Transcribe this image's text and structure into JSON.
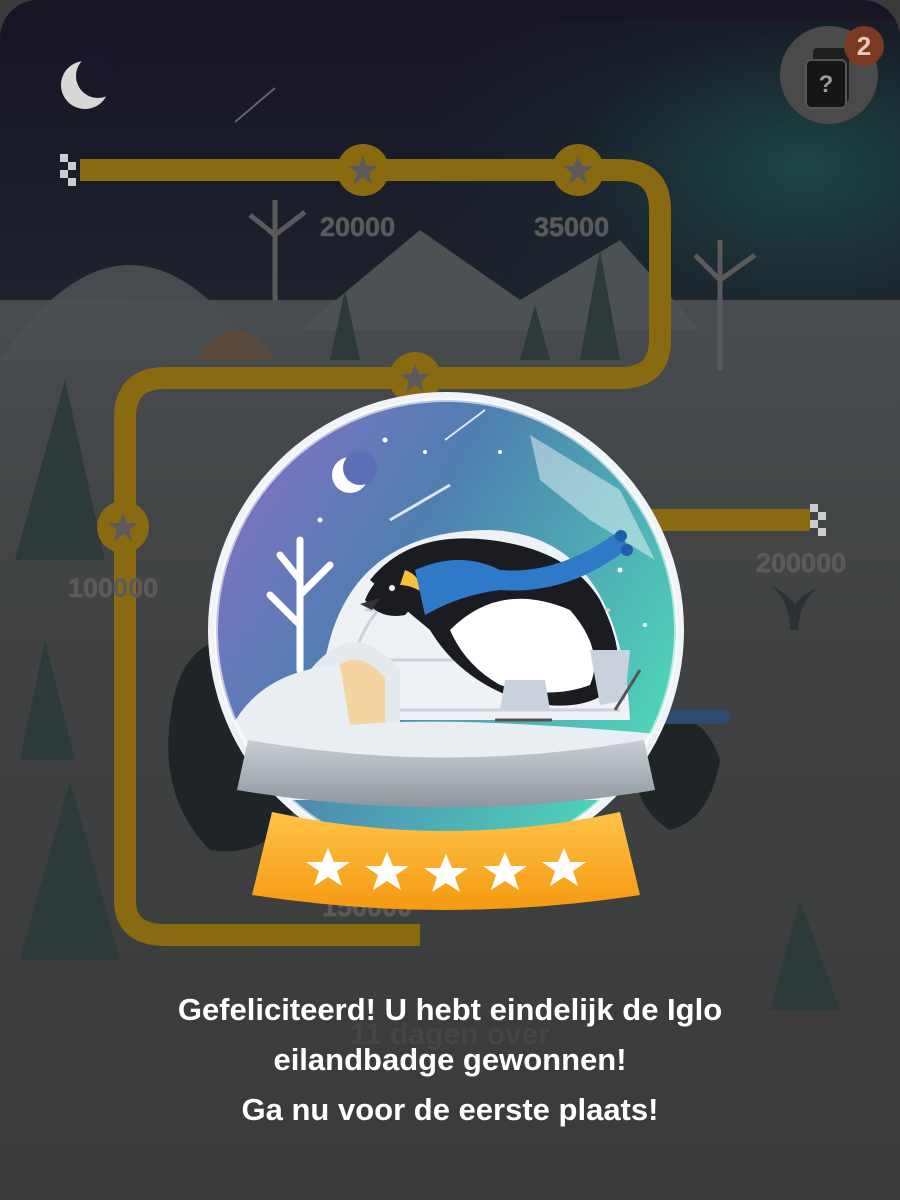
{
  "background_map": {
    "milestones": [
      "20000",
      "35000",
      "100000",
      "200000",
      "150000"
    ],
    "days_left": "11 dagen over"
  },
  "inbox": {
    "icon": "mystery-box-icon",
    "glyph": "?",
    "badge_count": "2"
  },
  "reward": {
    "badge_name": "Iglo eilandbadge",
    "stars": 5
  },
  "message": {
    "line1": "Gefeliciteerd! U hebt eindelijk de Iglo",
    "line2": "eilandbadge gewonnen!",
    "line3": "Ga nu voor de eerste plaats!"
  },
  "colors": {
    "accent": "#f5a623",
    "dim_path": "#8a6a10",
    "overlay": "#3d3d3d",
    "text": "#ffffff"
  }
}
